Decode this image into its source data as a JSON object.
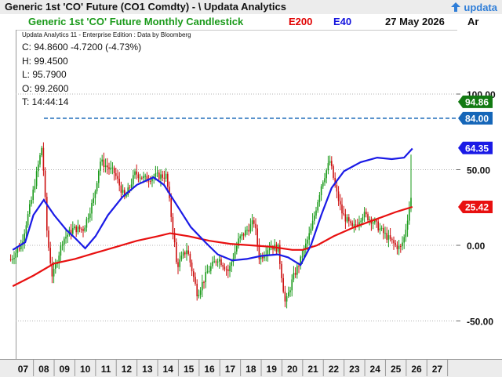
{
  "window": {
    "title": "Generic 1st 'CO' Future (CO1 Comdty) - \\ Updata Analytics",
    "logo_text": "updata"
  },
  "header": {
    "chart_title": "Generic 1st 'CO' Future Monthly Candlestick",
    "e200_label": "E200",
    "e40_label": "E40",
    "date": "27 May 2026",
    "ar_label": "Ar"
  },
  "info": {
    "subtitle": "Updata Analytics 11 - Enterprise Edition : Data by Bloomberg",
    "close": "C: 94.8600  -4.7200 (-4.73%)",
    "high": "H: 99.4500",
    "low": "L: 95.7900",
    "open": "O: 99.2600",
    "time": "T: 14:44:14"
  },
  "colors": {
    "up": "#1a9a1a",
    "down": "#cc1111",
    "e40": "#1a1ae6",
    "e200": "#e81010",
    "level_line": "#1566b8",
    "price_box": "#127a12",
    "e40_box": "#1a1ae6",
    "e200_box": "#e81010"
  },
  "chart_data": {
    "type": "candlestick",
    "title": "Generic 1st 'CO' Future Monthly Candlestick",
    "y_ticks": [
      "100.00",
      "50.00",
      "0.00",
      "-50.00"
    ],
    "y_tick_values": [
      100,
      50,
      0,
      -50
    ],
    "ylim": [
      -65,
      125
    ],
    "x_tick_labels": [
      "07",
      "08",
      "09",
      "10",
      "11",
      "12",
      "13",
      "14",
      "15",
      "16",
      "17",
      "18",
      "19",
      "20",
      "21",
      "22",
      "23",
      "24",
      "25",
      "26",
      "27"
    ],
    "x_start_year": 2007,
    "xlim_years": [
      2006.9,
      2027.5
    ],
    "grid": true,
    "horizontal_level": 84.0,
    "labels": [
      {
        "text": "94.86",
        "value": 94.86,
        "kind": "price"
      },
      {
        "text": "84.00",
        "value": 84.0,
        "kind": "level"
      },
      {
        "text": "64.35",
        "value": 64.35,
        "kind": "e40"
      },
      {
        "text": "25.42",
        "value": 25.42,
        "kind": "e200"
      }
    ],
    "anchors": [
      [
        2007.0,
        55
      ],
      [
        2007.5,
        65
      ],
      [
        2008.0,
        95
      ],
      [
        2008.5,
        130
      ],
      [
        2008.75,
        70
      ],
      [
        2009.0,
        43
      ],
      [
        2009.5,
        68
      ],
      [
        2010.0,
        75
      ],
      [
        2010.5,
        75
      ],
      [
        2011.0,
        95
      ],
      [
        2011.3,
        120
      ],
      [
        2012.0,
        112
      ],
      [
        2012.5,
        95
      ],
      [
        2013.0,
        112
      ],
      [
        2013.5,
        108
      ],
      [
        2014.0,
        110
      ],
      [
        2014.5,
        110
      ],
      [
        2014.9,
        65
      ],
      [
        2015.0,
        50
      ],
      [
        2015.5,
        62
      ],
      [
        2016.0,
        32
      ],
      [
        2016.5,
        47
      ],
      [
        2017.0,
        56
      ],
      [
        2017.5,
        47
      ],
      [
        2018.0,
        68
      ],
      [
        2018.75,
        80
      ],
      [
        2019.0,
        55
      ],
      [
        2019.5,
        64
      ],
      [
        2019.9,
        62
      ],
      [
        2020.25,
        25
      ],
      [
        2020.6,
        42
      ],
      [
        2021.0,
        55
      ],
      [
        2021.5,
        75
      ],
      [
        2022.0,
        105
      ],
      [
        2022.4,
        120
      ],
      [
        2022.7,
        100
      ],
      [
        2023.0,
        85
      ],
      [
        2023.5,
        75
      ],
      [
        2024.0,
        85
      ],
      [
        2024.5,
        80
      ],
      [
        2025.0,
        72
      ],
      [
        2025.5,
        65
      ],
      [
        2025.8,
        62
      ],
      [
        2026.0,
        70
      ],
      [
        2026.3,
        95
      ]
    ],
    "price_offset": 64.2,
    "e40_points": [
      [
        2007.0,
        -3
      ],
      [
        2007.6,
        2
      ],
      [
        2008.0,
        20
      ],
      [
        2008.5,
        30
      ],
      [
        2009.0,
        20
      ],
      [
        2009.6,
        10
      ],
      [
        2010.0,
        5
      ],
      [
        2010.5,
        -2
      ],
      [
        2011.0,
        6
      ],
      [
        2011.6,
        20
      ],
      [
        2012.3,
        32
      ],
      [
        2013.0,
        40
      ],
      [
        2013.8,
        45
      ],
      [
        2014.3,
        40
      ],
      [
        2015.0,
        25
      ],
      [
        2015.6,
        12
      ],
      [
        2016.3,
        2
      ],
      [
        2016.9,
        -6
      ],
      [
        2017.6,
        -10
      ],
      [
        2018.3,
        -9
      ],
      [
        2019.0,
        -7
      ],
      [
        2019.8,
        -6
      ],
      [
        2020.3,
        -8
      ],
      [
        2020.9,
        -13
      ],
      [
        2021.4,
        0
      ],
      [
        2021.9,
        20
      ],
      [
        2022.4,
        38
      ],
      [
        2023.0,
        49
      ],
      [
        2023.8,
        55
      ],
      [
        2024.6,
        58
      ],
      [
        2025.3,
        57
      ],
      [
        2025.9,
        58
      ],
      [
        2026.3,
        64
      ]
    ],
    "e200_points": [
      [
        2007.0,
        -27
      ],
      [
        2008.0,
        -20
      ],
      [
        2009.0,
        -12
      ],
      [
        2010.0,
        -9
      ],
      [
        2011.0,
        -5
      ],
      [
        2012.0,
        -1
      ],
      [
        2013.0,
        3
      ],
      [
        2014.0,
        6
      ],
      [
        2014.6,
        8
      ],
      [
        2015.5,
        6
      ],
      [
        2016.5,
        3
      ],
      [
        2017.5,
        1
      ],
      [
        2018.5,
        0
      ],
      [
        2019.5,
        -1
      ],
      [
        2020.5,
        -3
      ],
      [
        2021.0,
        -3
      ],
      [
        2021.7,
        0
      ],
      [
        2022.5,
        6
      ],
      [
        2023.5,
        12
      ],
      [
        2024.5,
        17
      ],
      [
        2025.5,
        22
      ],
      [
        2026.3,
        25.4
      ]
    ]
  }
}
